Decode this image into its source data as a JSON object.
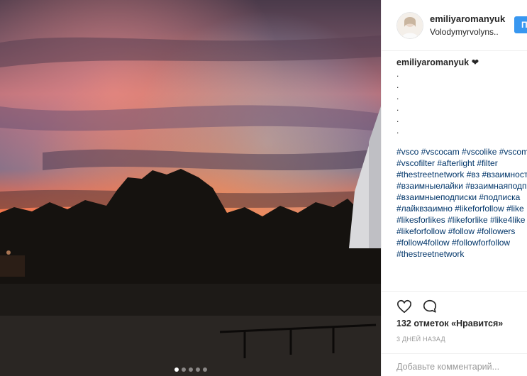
{
  "post": {
    "images_count": 5,
    "active_image": 1
  },
  "header": {
    "username": "emiliyaromanyuk",
    "location": "Volodymyrvolyns..",
    "follow_label": "Подписаться"
  },
  "caption": {
    "username": "emiliyaromanyuk",
    "text": " ❤",
    "dots": [
      ".",
      ".",
      ".",
      ".",
      ".",
      "."
    ]
  },
  "hashtags": [
    "#vsco #vscocam #vscolike #vscomoment",
    "#vscofilter #afterlight #filter",
    "#thestreetnetwork #вз #взаимность",
    "#взаимныелайки #взаимнаяподписка",
    "#взаимныеподписки #подписка",
    "#лайквзаимно #likeforfollow #like",
    "#likesforlikes #likeforlike #like4like",
    "#likeforfollow #follow #followers",
    "#follow4follow #followforfollow",
    "#thestreetnetwork"
  ],
  "actions": {
    "like_icon": "heart-icon",
    "comment_icon": "comment-bubble-icon",
    "likes_text": "132 отметок «Нравится»",
    "time_text": "3 ДНЕЙ НАЗАД"
  },
  "add_comment": {
    "placeholder": "Добавьте комментарий..."
  },
  "colors": {
    "link": "#003569",
    "follow_button": "#3897f0",
    "divider": "#efefef",
    "muted": "#999999"
  }
}
